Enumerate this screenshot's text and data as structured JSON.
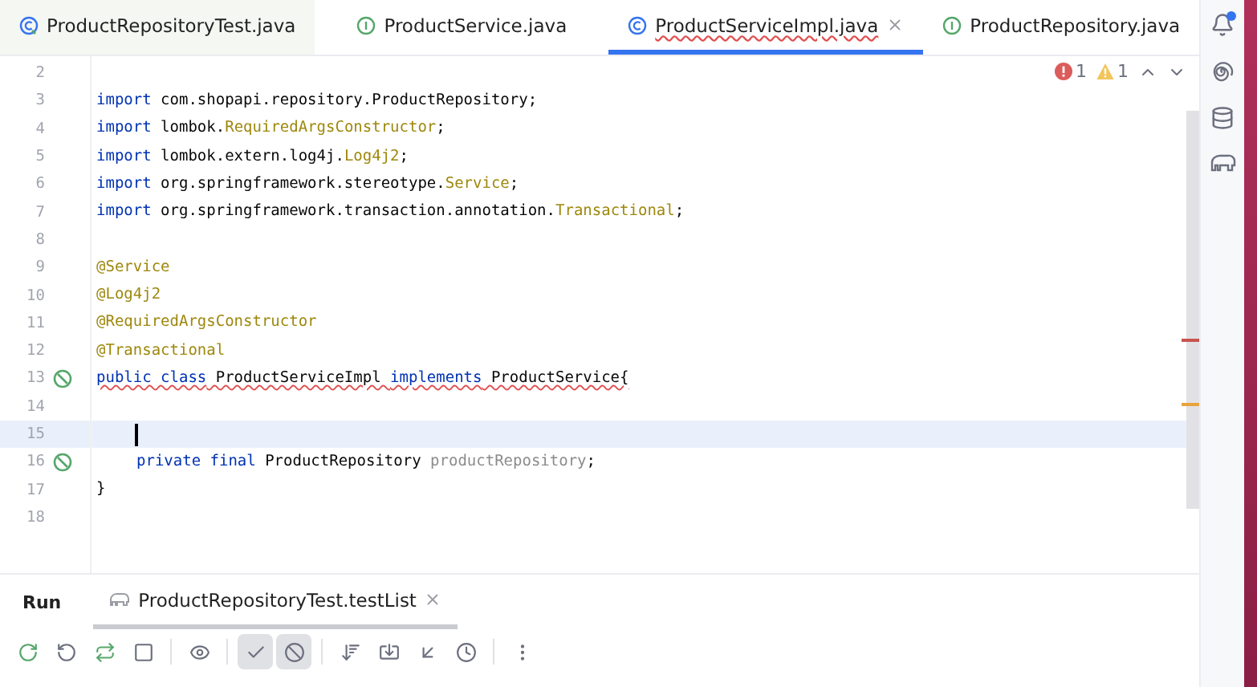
{
  "tabs": [
    {
      "label": "ProductRepositoryTest.java",
      "kind": "test-class",
      "selected": false,
      "error_underline": false
    },
    {
      "label": "ProductService.java",
      "kind": "interface",
      "selected": false,
      "error_underline": false
    },
    {
      "label": "ProductServiceImpl.java",
      "kind": "class",
      "selected": true,
      "error_underline": true
    },
    {
      "label": "ProductRepository.java",
      "kind": "interface",
      "selected": false,
      "error_underline": false
    }
  ],
  "problems": {
    "errors": "1",
    "warnings": "1"
  },
  "code_lines": [
    {
      "number": "2",
      "current": false,
      "gutter_icon": false
    },
    {
      "number": "3",
      "current": false,
      "gutter_icon": false,
      "error_underline": false,
      "tokens": [
        {
          "kind": "keyword",
          "text": "import"
        },
        {
          "kind": "plain",
          "text": " com.shopapi.repository.ProductRepository;"
        }
      ]
    },
    {
      "number": "4",
      "current": false,
      "gutter_icon": false,
      "error_underline": false,
      "tokens": [
        {
          "kind": "keyword",
          "text": "import"
        },
        {
          "kind": "plain",
          "text": " lombok."
        },
        {
          "kind": "annotation",
          "text": "RequiredArgsConstructor"
        },
        {
          "kind": "plain",
          "text": ";"
        }
      ]
    },
    {
      "number": "5",
      "current": false,
      "gutter_icon": false,
      "error_underline": false,
      "tokens": [
        {
          "kind": "keyword",
          "text": "import"
        },
        {
          "kind": "plain",
          "text": " lombok.extern.log4j."
        },
        {
          "kind": "annotation",
          "text": "Log4j2"
        },
        {
          "kind": "plain",
          "text": ";"
        }
      ]
    },
    {
      "number": "6",
      "current": false,
      "gutter_icon": false,
      "error_underline": false,
      "tokens": [
        {
          "kind": "keyword",
          "text": "import"
        },
        {
          "kind": "plain",
          "text": " org.springframework.stereotype."
        },
        {
          "kind": "annotation",
          "text": "Service"
        },
        {
          "kind": "plain",
          "text": ";"
        }
      ]
    },
    {
      "number": "7",
      "current": false,
      "gutter_icon": false,
      "error_underline": false,
      "tokens": [
        {
          "kind": "keyword",
          "text": "import"
        },
        {
          "kind": "plain",
          "text": " org.springframework.transaction.annotation."
        },
        {
          "kind": "annotation",
          "text": "Transactional"
        },
        {
          "kind": "plain",
          "text": ";"
        }
      ]
    },
    {
      "number": "8",
      "current": false,
      "gutter_icon": false
    },
    {
      "number": "9",
      "current": false,
      "gutter_icon": false,
      "error_underline": false,
      "tokens": [
        {
          "kind": "annotation",
          "text": "@Service"
        }
      ]
    },
    {
      "number": "10",
      "current": false,
      "gutter_icon": false,
      "error_underline": false,
      "tokens": [
        {
          "kind": "annotation",
          "text": "@Log4j2"
        }
      ]
    },
    {
      "number": "11",
      "current": false,
      "gutter_icon": false,
      "error_underline": false,
      "tokens": [
        {
          "kind": "annotation",
          "text": "@RequiredArgsConstructor"
        }
      ]
    },
    {
      "number": "12",
      "current": false,
      "gutter_icon": false,
      "error_underline": false,
      "tokens": [
        {
          "kind": "annotation",
          "text": "@Transactional"
        }
      ]
    },
    {
      "number": "13",
      "current": false,
      "gutter_icon": true,
      "error_underline": true,
      "tokens": [
        {
          "kind": "keyword",
          "text": "public class"
        },
        {
          "kind": "plain",
          "text": " ProductServiceImpl "
        },
        {
          "kind": "keyword",
          "text": "implements"
        },
        {
          "kind": "plain",
          "text": " ProductService{"
        }
      ]
    },
    {
      "number": "14",
      "current": false,
      "gutter_icon": false
    },
    {
      "number": "15",
      "current": true,
      "gutter_icon": false
    },
    {
      "number": "16",
      "current": false,
      "gutter_icon": true,
      "indented": true,
      "error_underline": false,
      "tokens": [
        {
          "kind": "keyword",
          "text": "private final"
        },
        {
          "kind": "plain",
          "text": " ProductRepository "
        },
        {
          "kind": "unused",
          "text": "productRepository"
        },
        {
          "kind": "plain",
          "text": ";"
        }
      ]
    },
    {
      "number": "17",
      "current": false,
      "gutter_icon": false,
      "error_underline": false,
      "tokens": [
        {
          "kind": "plain",
          "text": "}"
        }
      ]
    },
    {
      "number": "18",
      "current": false,
      "gutter_icon": false
    }
  ],
  "run_panel": {
    "title": "Run",
    "tab": {
      "label": "ProductRepositoryTest.testList",
      "selected": true
    },
    "toolbar": [
      {
        "kind": "rerun",
        "selected": false
      },
      {
        "kind": "rerun-failed",
        "selected": false
      },
      {
        "kind": "toggle-auto",
        "selected": false
      },
      {
        "kind": "stop",
        "selected": false
      },
      {
        "kind": "show-ignored",
        "selected": false
      },
      {
        "kind": "show-passed",
        "selected": true
      },
      {
        "kind": "show-ignored-tests",
        "selected": true
      },
      {
        "kind": "sort",
        "selected": false
      },
      {
        "kind": "import",
        "selected": false
      },
      {
        "kind": "collapse",
        "selected": false
      },
      {
        "kind": "history",
        "selected": false
      },
      {
        "kind": "more",
        "selected": false
      }
    ]
  }
}
